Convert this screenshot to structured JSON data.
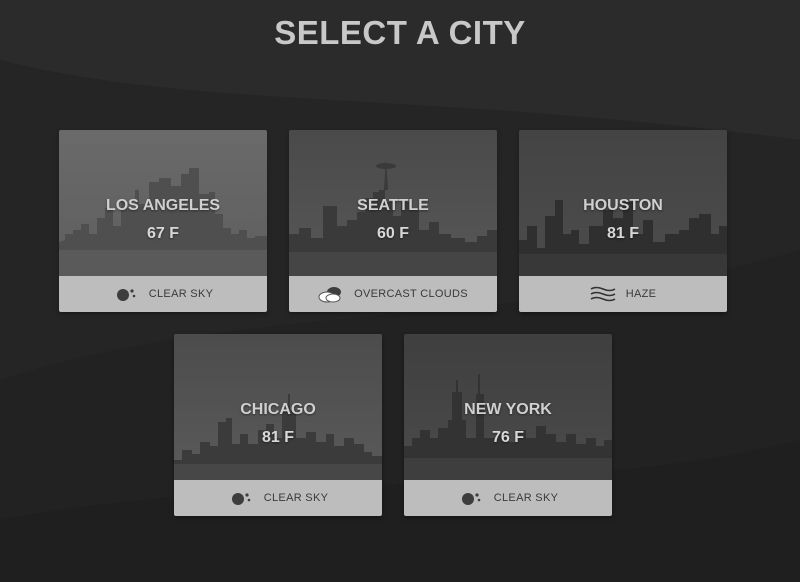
{
  "page": {
    "title": "SELECT A CITY"
  },
  "cities": [
    {
      "name": "LOS ANGELES",
      "temp": "67 F",
      "condition": "CLEAR SKY",
      "icon": "clear-sky-icon"
    },
    {
      "name": "SEATTLE",
      "temp": "60 F",
      "condition": "OVERCAST CLOUDS",
      "icon": "overcast-clouds-icon"
    },
    {
      "name": "HOUSTON",
      "temp": "81 F",
      "condition": "HAZE",
      "icon": "haze-icon"
    },
    {
      "name": "CHICAGO",
      "temp": "81 F",
      "condition": "CLEAR SKY",
      "icon": "clear-sky-icon"
    },
    {
      "name": "NEW YORK",
      "temp": "76 F",
      "condition": "CLEAR SKY",
      "icon": "clear-sky-icon"
    }
  ],
  "colors": {
    "background": "#252525",
    "card_footer": "#bdbdbd",
    "title": "#c8c8c8"
  }
}
